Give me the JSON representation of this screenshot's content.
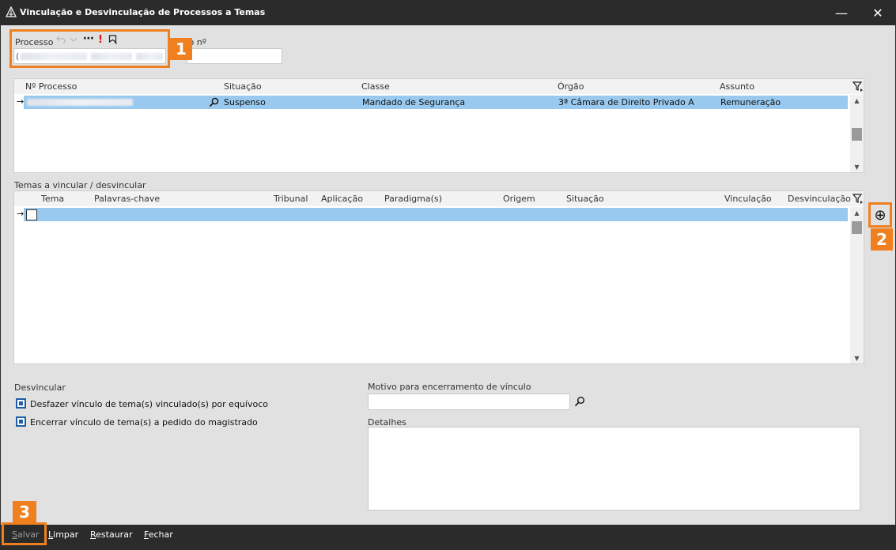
{
  "window": {
    "title": "Vinculação e Desvinculação de Processos a Temas",
    "minimize_glyph": "—",
    "close_glyph": "✕"
  },
  "processo": {
    "label": "Processo",
    "outro_label": "utro nº",
    "toolbar_glyph_more": "⋯",
    "toolbar_glyph_alert": "!",
    "value_prefix": "("
  },
  "processes_grid": {
    "columns": [
      "Nº Processo",
      "Situação",
      "Classe",
      "Órgão",
      "Assunto"
    ],
    "rows": [
      {
        "situacao": "Suspenso",
        "classe": "Mandado de Segurança",
        "orgao": "3ª Câmara de Direito Privado A",
        "assunto": "Remuneração"
      }
    ],
    "row_indicator": "→"
  },
  "temas": {
    "section_label": "Temas a vincular / desvincular",
    "columns": [
      "Tema",
      "Palavras-chave",
      "Tribunal",
      "Aplicação",
      "Paradigma(s)",
      "Origem",
      "Situação",
      "Vinculação",
      "Desvinculação"
    ],
    "row_indicator": "→",
    "add_glyph": "⊕"
  },
  "desvincular": {
    "section_label": "Desvincular",
    "options": [
      "Desfazer vínculo de tema(s) vinculado(s) por equívoco",
      "Encerrar vínculo de tema(s) a pedido do magistrado"
    ]
  },
  "motivo": {
    "label": "Motivo para encerramento de vínculo",
    "detalhes_label": "Detalhes"
  },
  "footer": {
    "salvar": {
      "first": "S",
      "rest": "alvar"
    },
    "limpar": {
      "first": "L",
      "rest": "impar"
    },
    "restaurar": {
      "first": "R",
      "rest": "estaurar"
    },
    "fechar": {
      "first": "F",
      "rest": "echar"
    }
  },
  "callouts": [
    "1",
    "2",
    "3"
  ],
  "colors": {
    "accent": "#f0801f",
    "selection": "#99c9ee",
    "background": "#e1e1e1",
    "titlebar": "#2b2b2b"
  }
}
